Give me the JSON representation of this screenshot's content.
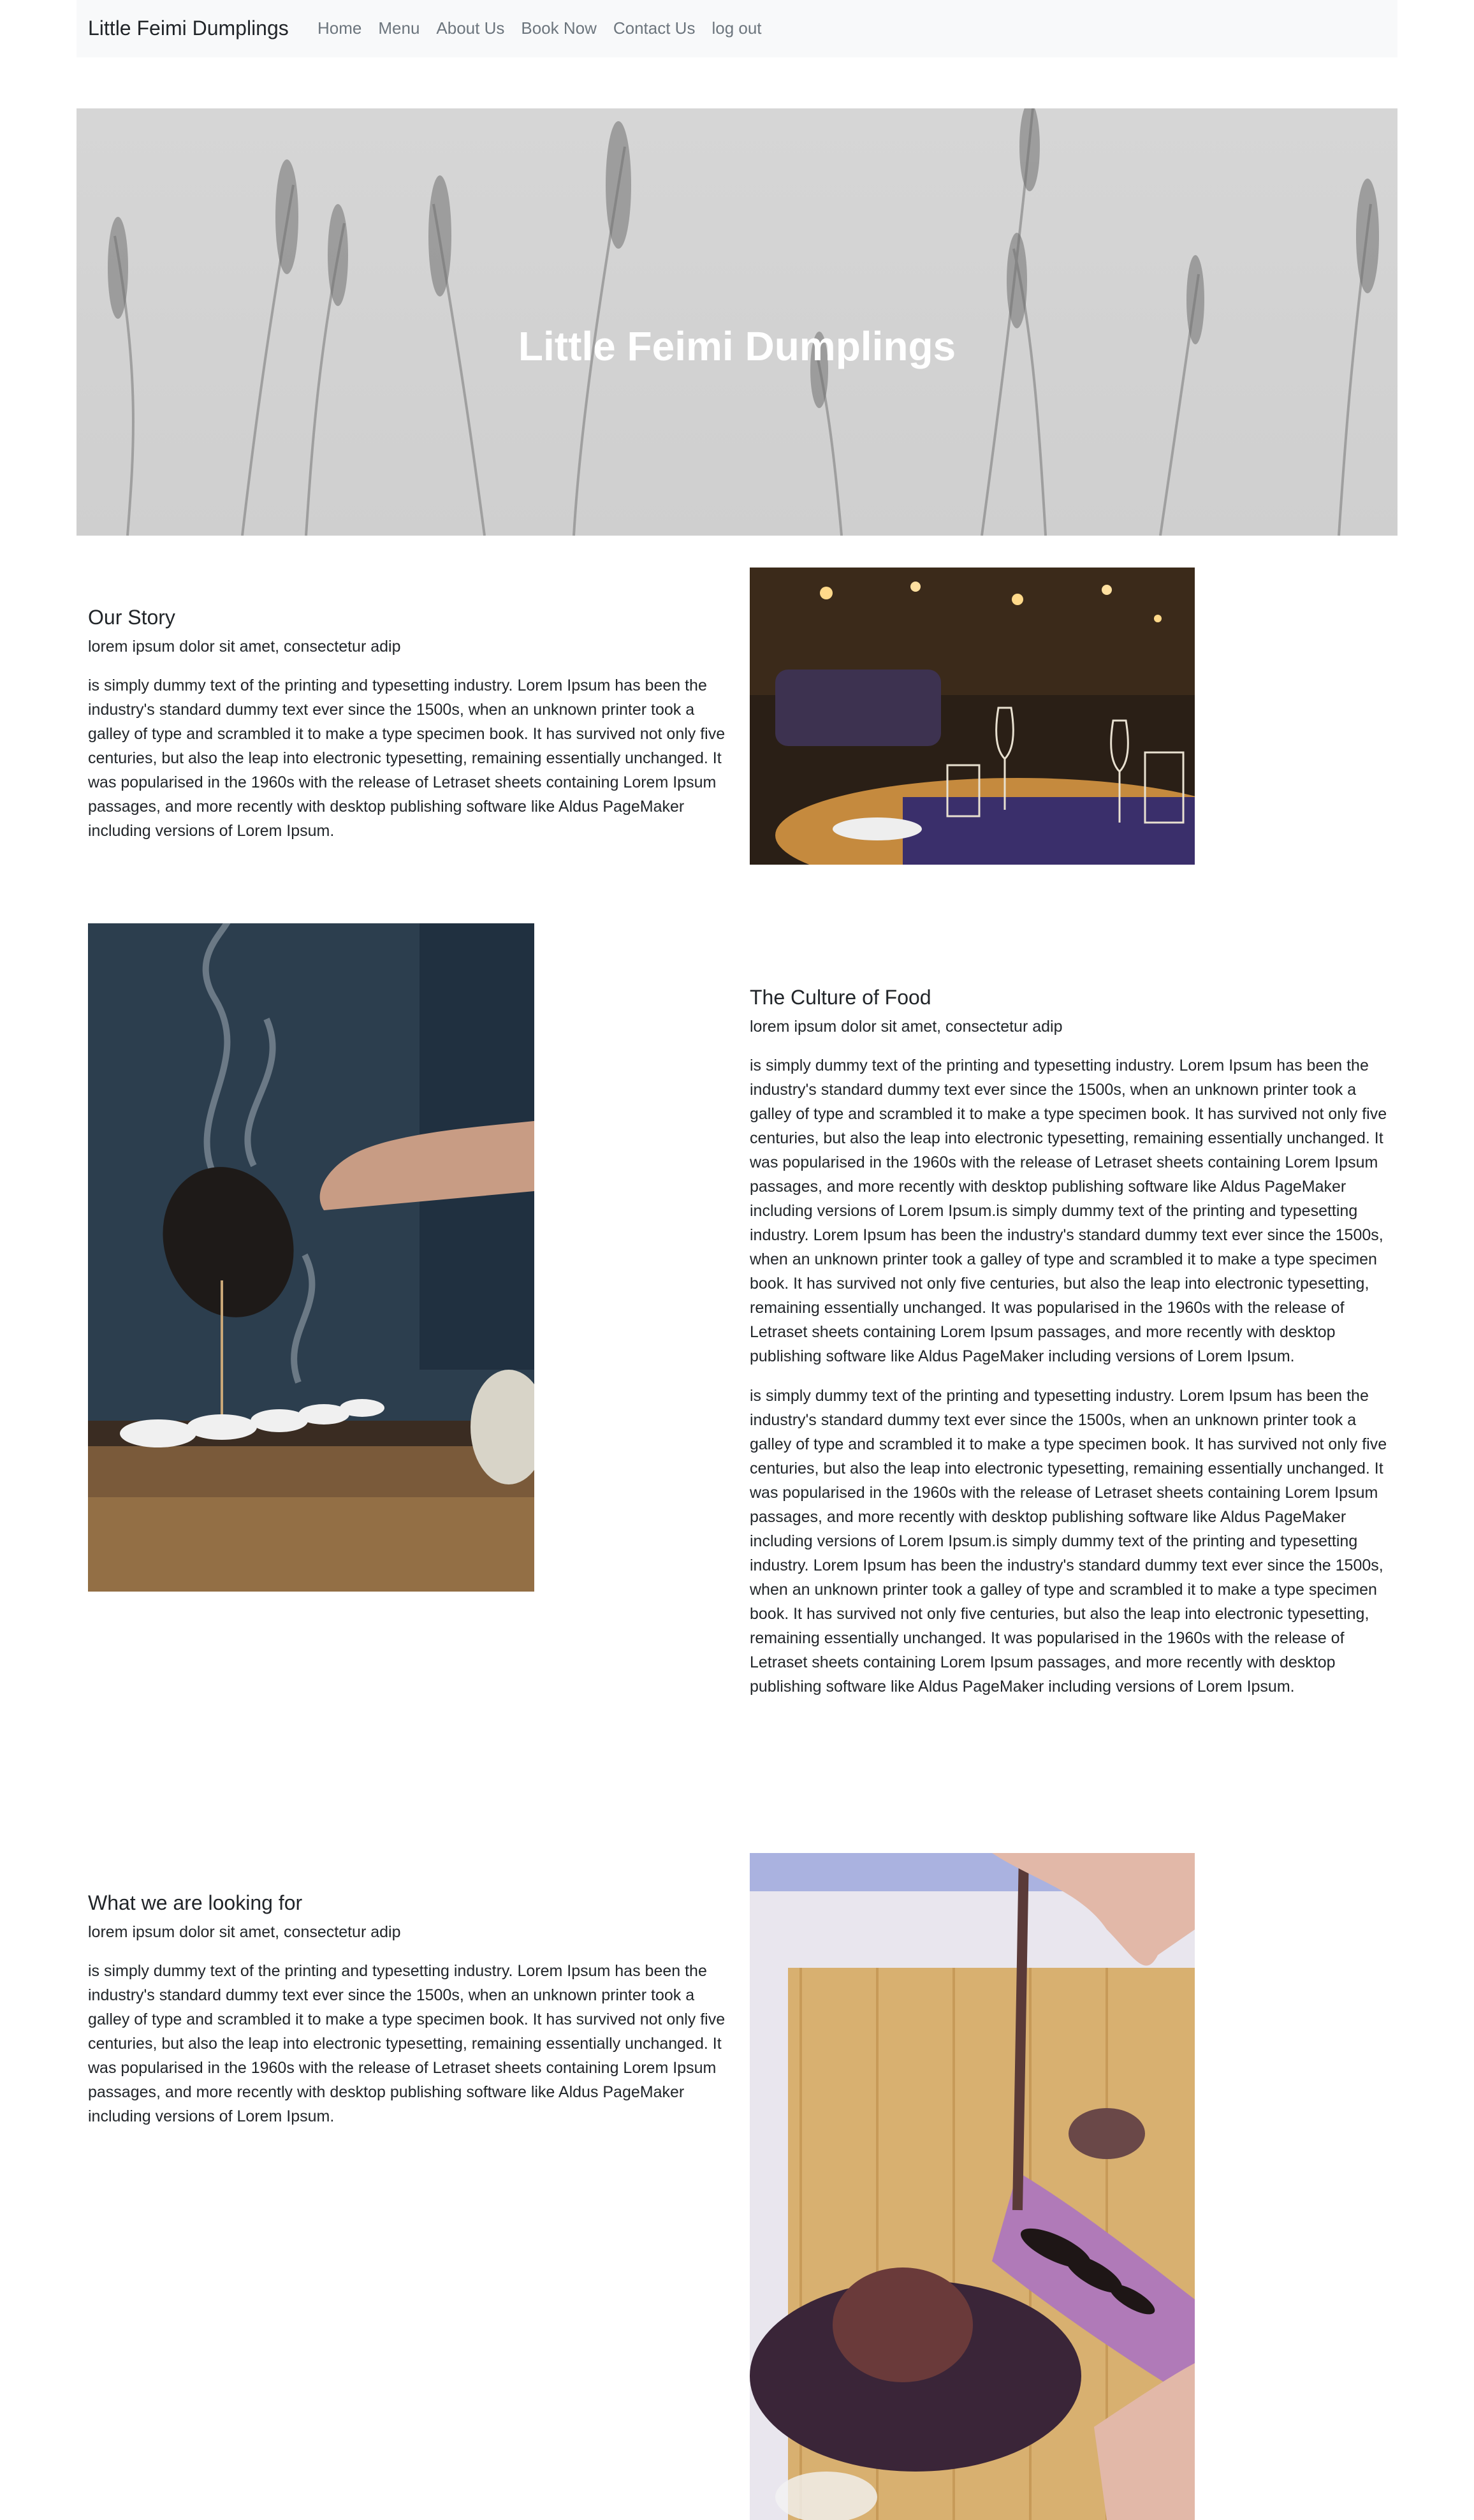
{
  "navbar": {
    "brand": "Little Feimi Dumplings",
    "links": [
      "Home",
      "Menu",
      "About Us",
      "Book Now",
      "Contact Us",
      "log out"
    ]
  },
  "hero": {
    "title": "Little Feimi Dumplings"
  },
  "sections": [
    {
      "title": "Our Story",
      "subtitle": "lorem ipsum dolor sit amet, consectetur adip",
      "paragraphs": [
        "is simply dummy text of the printing and typesetting industry. Lorem Ipsum has been the industry's standard dummy text ever since the 1500s, when an unknown printer took a galley of type and scrambled it to make a type specimen book. It has survived not only five centuries, but also the leap into electronic typesetting, remaining essentially unchanged. It was popularised in the 1960s with the release of Letraset sheets containing Lorem Ipsum passages, and more recently with desktop publishing software like Aldus PageMaker including versions of Lorem Ipsum."
      ]
    },
    {
      "title": "The Culture of Food",
      "subtitle": "lorem ipsum dolor sit amet, consectetur adip",
      "paragraphs": [
        "is simply dummy text of the printing and typesetting industry. Lorem Ipsum has been the industry's standard dummy text ever since the 1500s, when an unknown printer took a galley of type and scrambled it to make a type specimen book. It has survived not only five centuries, but also the leap into electronic typesetting, remaining essentially unchanged. It was popularised in the 1960s with the release of Letraset sheets containing Lorem Ipsum passages, and more recently with desktop publishing software like Aldus PageMaker including versions of Lorem Ipsum.is simply dummy text of the printing and typesetting industry. Lorem Ipsum has been the industry's standard dummy text ever since the 1500s, when an unknown printer took a galley of type and scrambled it to make a type specimen book. It has survived not only five centuries, but also the leap into electronic typesetting, remaining essentially unchanged. It was popularised in the 1960s with the release of Letraset sheets containing Lorem Ipsum passages, and more recently with desktop publishing software like Aldus PageMaker including versions of Lorem Ipsum.",
        "is simply dummy text of the printing and typesetting industry. Lorem Ipsum has been the industry's standard dummy text ever since the 1500s, when an unknown printer took a galley of type and scrambled it to make a type specimen book. It has survived not only five centuries, but also the leap into electronic typesetting, remaining essentially unchanged. It was popularised in the 1960s with the release of Letraset sheets containing Lorem Ipsum passages, and more recently with desktop publishing software like Aldus PageMaker including versions of Lorem Ipsum.is simply dummy text of the printing and typesetting industry. Lorem Ipsum has been the industry's standard dummy text ever since the 1500s, when an unknown printer took a galley of type and scrambled it to make a type specimen book. It has survived not only five centuries, but also the leap into electronic typesetting, remaining essentially unchanged. It was popularised in the 1960s with the release of Letraset sheets containing Lorem Ipsum passages, and more recently with desktop publishing software like Aldus PageMaker including versions of Lorem Ipsum."
      ]
    },
    {
      "title": "What we are looking for",
      "subtitle": "lorem ipsum dolor sit amet, consectetur adip",
      "paragraphs": [
        "is simply dummy text of the printing and typesetting industry. Lorem Ipsum has been the industry's standard dummy text ever since the 1500s, when an unknown printer took a galley of type and scrambled it to make a type specimen book. It has survived not only five centuries, but also the leap into electronic typesetting, remaining essentially unchanged. It was popularised in the 1960s with the release of Letraset sheets containing Lorem Ipsum passages, and more recently with desktop publishing software like Aldus PageMaker including versions of Lorem Ipsum."
      ]
    }
  ],
  "colors": {
    "navbar_bg": "#f8f9fa",
    "nav_link": "#6c757d",
    "text": "#212529",
    "hero_bg": "#d3d3d3"
  }
}
